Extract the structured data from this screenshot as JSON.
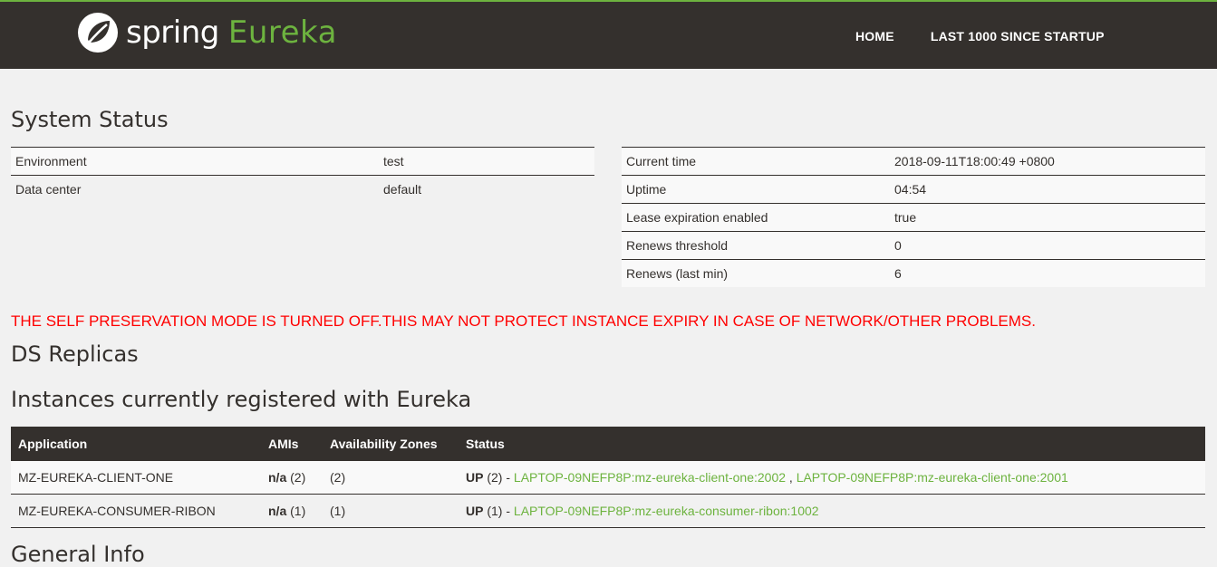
{
  "header": {
    "logo_spring": "spring",
    "logo_eureka": "Eureka",
    "nav": [
      {
        "label": "HOME"
      },
      {
        "label": "LAST 1000 SINCE STARTUP"
      }
    ]
  },
  "system_status": {
    "title": "System Status",
    "left": [
      {
        "key": "Environment",
        "value": "test"
      },
      {
        "key": "Data center",
        "value": "default"
      }
    ],
    "right": [
      {
        "key": "Current time",
        "value": "2018-09-11T18:00:49 +0800"
      },
      {
        "key": "Uptime",
        "value": "04:54"
      },
      {
        "key": "Lease expiration enabled",
        "value": "true"
      },
      {
        "key": "Renews threshold",
        "value": "0"
      },
      {
        "key": "Renews (last min)",
        "value": "6"
      }
    ]
  },
  "warning": "THE SELF PRESERVATION MODE IS TURNED OFF.THIS MAY NOT PROTECT INSTANCE EXPIRY IN CASE OF NETWORK/OTHER PROBLEMS.",
  "ds_replicas": {
    "title": "DS Replicas"
  },
  "instances": {
    "title": "Instances currently registered with Eureka",
    "columns": [
      "Application",
      "AMIs",
      "Availability Zones",
      "Status"
    ],
    "rows": [
      {
        "application": "MZ-EUREKA-CLIENT-ONE",
        "amis_label": "n/a",
        "amis_count": "(2)",
        "zones": "(2)",
        "status_label": "UP",
        "status_count": "(2) -",
        "links": [
          "LAPTOP-09NEFP8P:mz-eureka-client-one:2002",
          "LAPTOP-09NEFP8P:mz-eureka-client-one:2001"
        ],
        "link_sep": ","
      },
      {
        "application": "MZ-EUREKA-CONSUMER-RIBON",
        "amis_label": "n/a",
        "amis_count": "(1)",
        "zones": "(1)",
        "status_label": "UP",
        "status_count": "(1) -",
        "links": [
          "LAPTOP-09NEFP8P:mz-eureka-consumer-ribon:1002"
        ]
      }
    ]
  },
  "general_info": {
    "title": "General Info"
  },
  "colors": {
    "header_bg": "#34302d",
    "brand_green": "#6db33f",
    "page_bg": "#f1f1f1",
    "warning_red": "#ff0000"
  }
}
